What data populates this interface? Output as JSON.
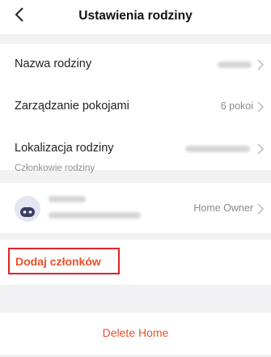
{
  "header": {
    "title": "Ustawienia rodziny",
    "back_icon": "chevron-left-icon"
  },
  "settings": {
    "family_name_label": "Nazwa rodziny",
    "rooms_label": "Zarządzanie pokojami",
    "rooms_value": "6 pokoi",
    "location_label": "Lokalizacja rodziny"
  },
  "members_section": {
    "title": "Członkowie rodziny",
    "member_role": "Home Owner"
  },
  "actions": {
    "add_members": "Dodaj członków",
    "delete_home": "Delete Home"
  },
  "colors": {
    "accent": "#e8512a",
    "highlight_border": "#e0222a",
    "background": "#f2f2f4"
  }
}
